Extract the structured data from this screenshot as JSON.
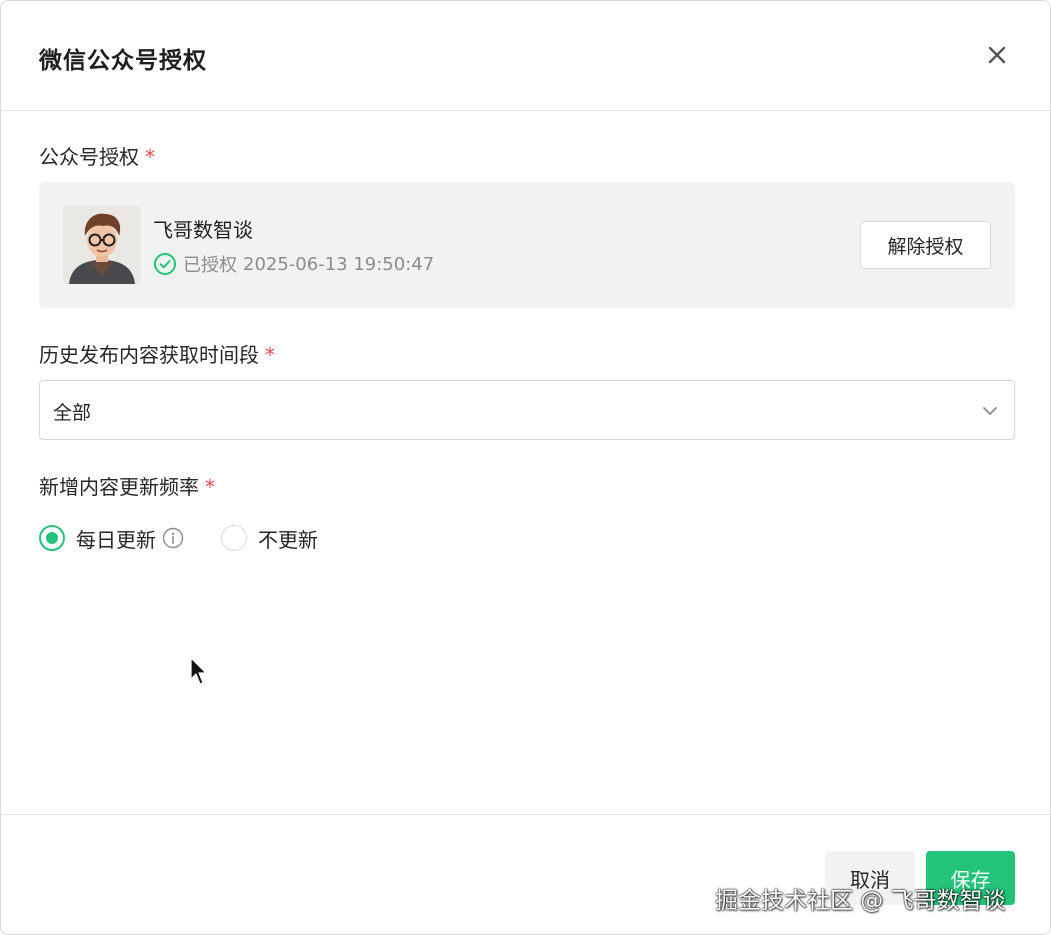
{
  "modal": {
    "title": "微信公众号授权"
  },
  "account_section": {
    "label": "公众号授权",
    "required_mark": "*",
    "account": {
      "name": "飞哥数智谈",
      "status_text": "已授权",
      "authorized_at": "2025-06-13 19:50:47"
    },
    "unauthorize_button": "解除授权"
  },
  "history_section": {
    "label": "历史发布内容获取时间段",
    "required_mark": "*",
    "selected_value": "全部"
  },
  "frequency_section": {
    "label": "新增内容更新频率",
    "required_mark": "*",
    "options": [
      {
        "label": "每日更新",
        "checked": true
      },
      {
        "label": "不更新",
        "checked": false
      }
    ]
  },
  "footer": {
    "cancel_label": "取消",
    "save_label": "保存"
  },
  "watermark": "掘金技术社区 @ 飞哥数智谈",
  "colors": {
    "accent": "#23c37a",
    "required": "#e5484d",
    "card_bg": "#f2f2f2"
  },
  "icons": {
    "close": "close-icon",
    "authorized": "check-circle-icon",
    "dropdown": "chevron-down-icon",
    "info": "info-icon"
  }
}
